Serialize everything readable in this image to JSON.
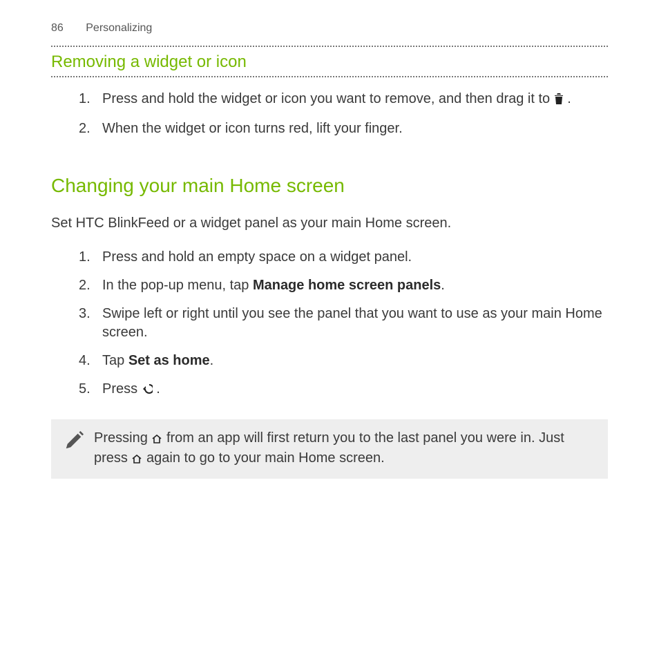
{
  "header": {
    "page_number": "86",
    "section": "Personalizing"
  },
  "removing": {
    "title": "Removing a widget or icon",
    "step1_a": "Press and hold the widget or icon you want to remove, and then drag it to ",
    "step1_b": " .",
    "step2": "When the widget or icon turns red, lift your finger."
  },
  "changing": {
    "title": "Changing your main Home screen",
    "intro": "Set HTC BlinkFeed or a widget panel as your main Home screen.",
    "step1": "Press and hold an empty space on a widget panel.",
    "step2_a": "In the pop-up menu, tap ",
    "step2_bold": "Manage home screen panels",
    "step2_b": ".",
    "step3": "Swipe left or right until you see the panel that you want to use as your main Home screen.",
    "step4_a": "Tap ",
    "step4_bold": "Set as home",
    "step4_b": ".",
    "step5_a": "Press ",
    "step5_b": " ."
  },
  "note": {
    "a": "Pressing ",
    "b": " from an app will first return you to the last panel you were in. Just press ",
    "c": " again to go to your main Home screen."
  },
  "nums": {
    "n1": "1.",
    "n2": "2.",
    "n3": "3.",
    "n4": "4.",
    "n5": "5."
  }
}
